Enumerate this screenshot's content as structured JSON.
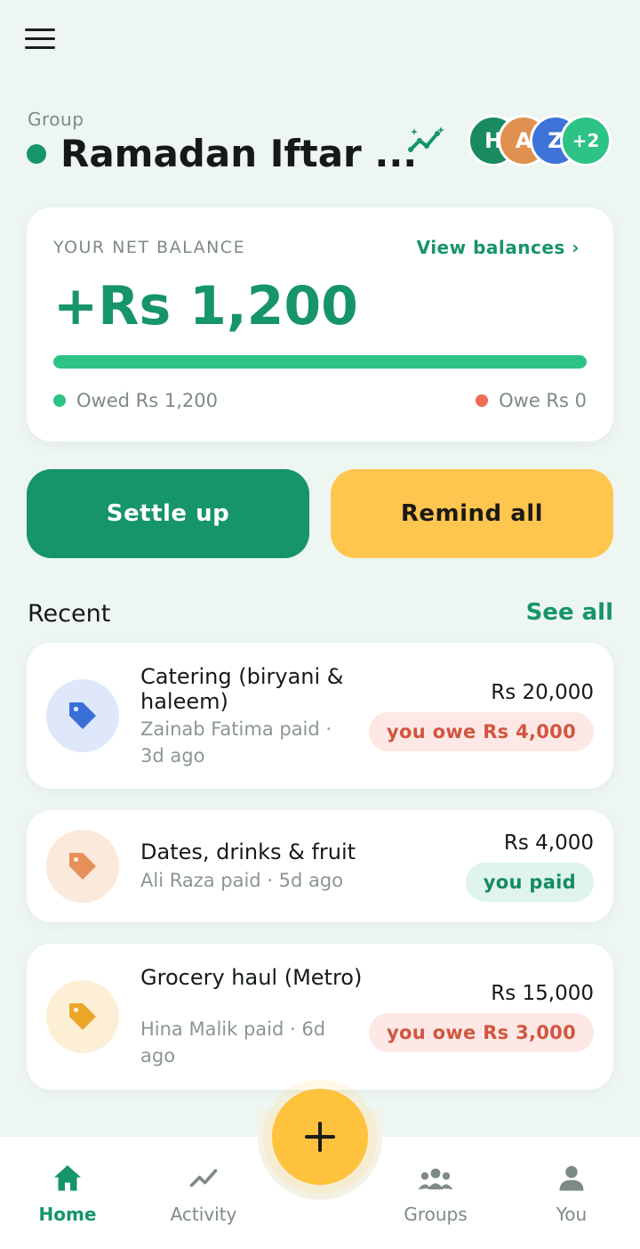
{
  "header": {
    "menu_icon": "hamburger-menu-icon",
    "group_label": "Group",
    "group_title": "Ramadan Iftar ...",
    "trend_icon": "sparkle-trend-icon",
    "avatars": [
      {
        "initial": "H",
        "color": "#1a8a5f"
      },
      {
        "initial": "A",
        "color": "#e0914f"
      },
      {
        "initial": "Z",
        "color": "#3f73d8"
      },
      {
        "initial": "+2",
        "color": "#2dc286"
      }
    ]
  },
  "balance": {
    "label": "YOUR NET BALANCE",
    "view_link": "View balances ›",
    "amount": "+Rs 1,200",
    "owed_fraction": 1.0,
    "owed_label": "Owed Rs 1,200",
    "owe_label": "Owe Rs 0",
    "owed_color": "#2dc286",
    "owe_color": "#ee6b55"
  },
  "actions": {
    "settle": "Settle up",
    "remind": "Remind all"
  },
  "recent": {
    "title": "Recent",
    "see_all": "See all",
    "items": [
      {
        "title": "Catering (biryani & haleem)",
        "subtitle": "Zainab Fatima paid · 3d ago",
        "amount": "Rs 20,000",
        "status": "you owe Rs 4,000",
        "status_type": "owe",
        "icon": "tag-icon",
        "icon_color": "#3a6fd8",
        "icon_bg": "#dfe8fa"
      },
      {
        "title": "Dates, drinks & fruit",
        "subtitle": "Ali Raza paid · 5d ago",
        "amount": "Rs 4,000",
        "status": "you paid",
        "status_type": "paid",
        "icon": "tag-icon",
        "icon_color": "#e6915a",
        "icon_bg": "#fbe9dc"
      },
      {
        "title": "Grocery haul (Metro)",
        "subtitle": "Hina Malik paid · 6d ago",
        "amount": "Rs 15,000",
        "status": "you owe Rs 3,000",
        "status_type": "owe",
        "icon": "tag-icon",
        "icon_color": "#eba62a",
        "icon_bg": "#fcefd6"
      }
    ]
  },
  "fab": {
    "icon": "plus-icon"
  },
  "nav": [
    {
      "label": "Home",
      "icon": "home-icon",
      "active": true
    },
    {
      "label": "Activity",
      "icon": "activity-icon",
      "active": false
    },
    {
      "label": "Groups",
      "icon": "groups-icon",
      "active": false
    },
    {
      "label": "You",
      "icon": "user-icon",
      "active": false
    }
  ],
  "colors": {
    "accent": "#16946b",
    "accent_light": "#2dc286",
    "warning": "#ffc64f",
    "background": "#eef6f1"
  }
}
